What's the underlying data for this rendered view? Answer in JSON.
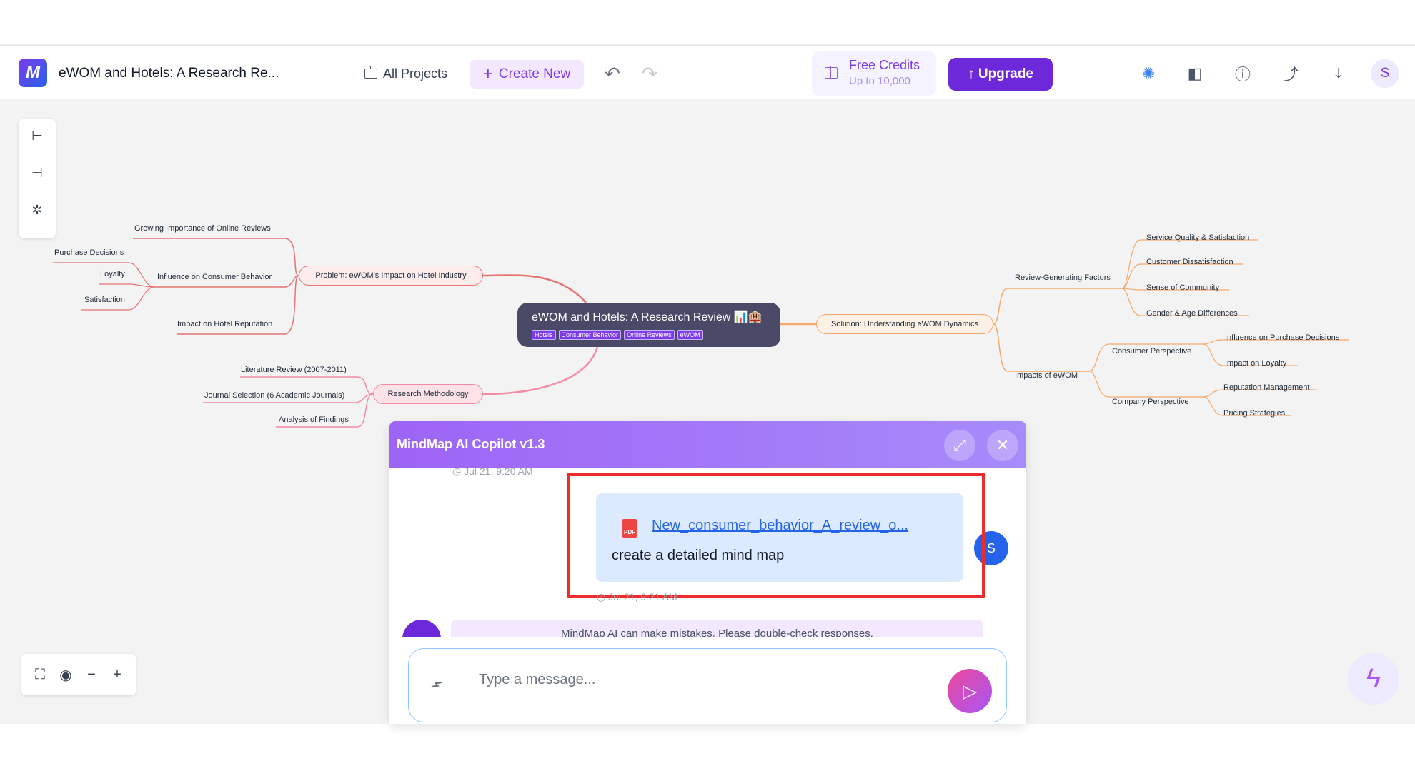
{
  "header": {
    "doc_title": "eWOM and Hotels: A Research Re...",
    "all_projects": "All Projects",
    "create_new": "Create New",
    "credits_title": "Free Credits",
    "credits_sub": "Up to 10,000",
    "upgrade": "↑ Upgrade",
    "avatar_letter": "S",
    "icons": [
      "theme-icon",
      "layout-icon",
      "help-icon",
      "share-icon",
      "download-icon"
    ]
  },
  "mindmap": {
    "central": {
      "title": "eWOM and Hotels: A Research Review 📊🏨",
      "tags": [
        "Hotels",
        "Consumer Behavior",
        "Online Reviews",
        "eWOM"
      ]
    },
    "problem": {
      "label": "Problem: eWOM's Impact on Hotel Industry",
      "children": [
        "Growing Importance of Online Reviews",
        "Influence on Consumer Behavior",
        "Impact on Hotel Reputation"
      ],
      "behavior_children": [
        "Purchase Decisions",
        "Loyalty",
        "Satisfaction"
      ]
    },
    "methodology": {
      "label": "Research Methodology",
      "children": [
        "Literature Review (2007-2011)",
        "Journal Selection (6 Academic Journals)",
        "Analysis of Findings"
      ]
    },
    "solution": {
      "label": "Solution: Understanding eWOM Dynamics",
      "factors": {
        "label": "Review-Generating Factors",
        "children": [
          "Service Quality & Satisfaction",
          "Customer Dissatisfaction",
          "Sense of Community",
          "Gender & Age Differences"
        ]
      },
      "impacts": {
        "label": "Impacts of eWOM",
        "consumer": {
          "label": "Consumer Perspective",
          "children": [
            "Influence on Purchase Decisions",
            "Impact on Loyalty"
          ]
        },
        "company": {
          "label": "Company Perspective",
          "children": [
            "Reputation Management",
            "Pricing Strategies"
          ]
        }
      }
    }
  },
  "copilot": {
    "title": "MindMap AI Copilot v1.3",
    "timestamp_top": "Jul 21, 9:20 AM",
    "timestamp_bottom": "Jul 21, 9:21 AM",
    "file_name": "New_consumer_behavior_A_review_o...",
    "file_badge": "PDF",
    "message": "create a detailed mind map",
    "user_initial": "S",
    "disclaimer": "MindMap AI can make mistakes. Please double-check responses.",
    "input_placeholder": "Type a message..."
  },
  "colors": {
    "accent": "#6d28d9",
    "highlight": "#ef2b2b",
    "branch_problem": "#e57373",
    "branch_method": "#f48aa4",
    "branch_solution": "#f4a86b"
  }
}
